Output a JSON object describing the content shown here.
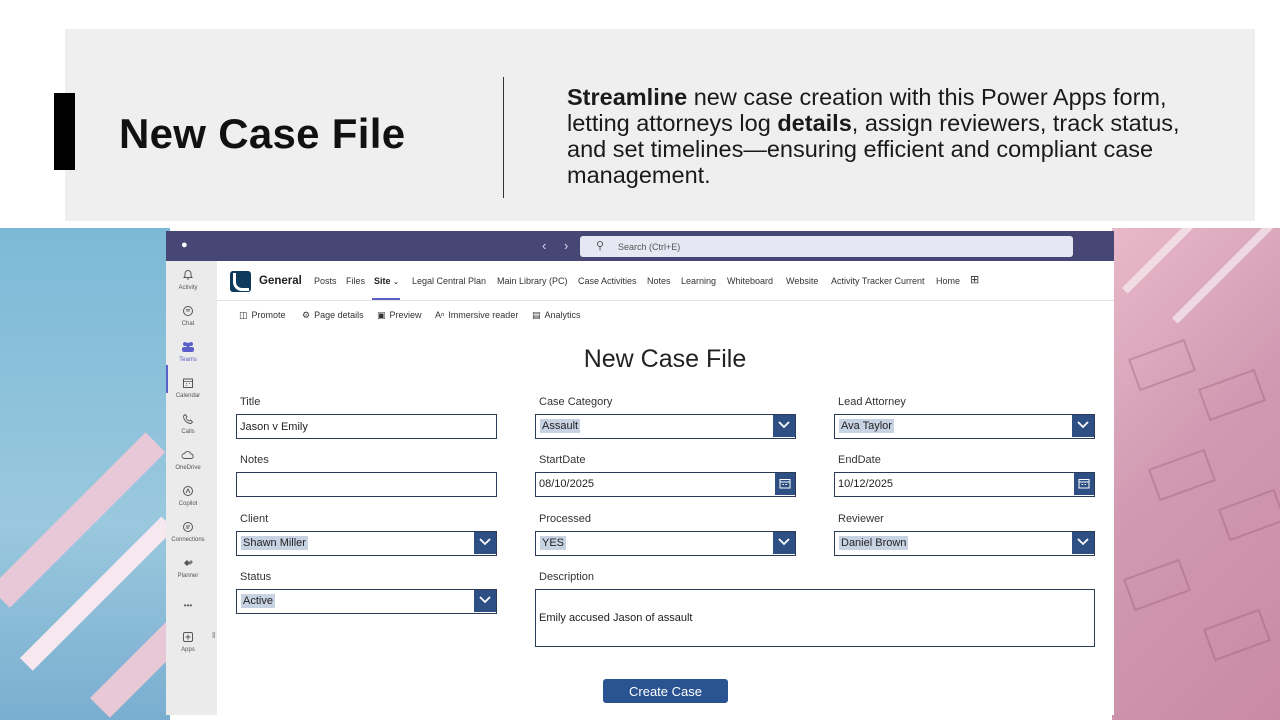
{
  "slide": {
    "title": "New Case File",
    "description_parts": {
      "bold1": "Streamline",
      "text1": " new case creation with this Power Apps form, letting attorneys log ",
      "bold2": "details",
      "text2": ", assign reviewers, track status, and set timelines—ensuring efficient and compliant case management."
    }
  },
  "window": {
    "search_placeholder": "Search (Ctrl+E)"
  },
  "rail": {
    "items": [
      {
        "label": "Activity",
        "icon": "bell-icon"
      },
      {
        "label": "Chat",
        "icon": "chat-icon"
      },
      {
        "label": "Teams",
        "icon": "teams-icon"
      },
      {
        "label": "Calendar",
        "icon": "calendar-icon"
      },
      {
        "label": "Calls",
        "icon": "phone-icon"
      },
      {
        "label": "OneDrive",
        "icon": "cloud-icon"
      },
      {
        "label": "Copilot",
        "icon": "copilot-icon"
      },
      {
        "label": "Connections",
        "icon": "connections-icon"
      },
      {
        "label": "Planner",
        "icon": "planner-icon"
      },
      {
        "label": "•••",
        "icon": "more-icon"
      },
      {
        "label": "Apps",
        "icon": "apps-icon"
      }
    ],
    "active": "Teams"
  },
  "channel": {
    "name": "General",
    "tabs": [
      "Posts",
      "Files",
      "Site",
      "Legal Central Plan",
      "Main Library (PC)",
      "Case Activities",
      "Notes",
      "Learning",
      "Whiteboard",
      "Website",
      "Activity Tracker Current",
      "Home"
    ],
    "active_tab": "Site"
  },
  "toolbar": {
    "items": [
      "Promote",
      "Page details",
      "Preview",
      "Immersive reader",
      "Analytics"
    ]
  },
  "form": {
    "title": "New Case File",
    "title_label": "Title",
    "title_value": "Jason v Emily",
    "notes_label": "Notes",
    "notes_value": "",
    "client_label": "Client",
    "client_value": "Shawn Miller",
    "status_label": "Status",
    "status_value": "Active",
    "case_category_label": "Case Category",
    "case_category_value": "Assault",
    "start_date_label": "StartDate",
    "start_date_value": "08/10/2025",
    "processed_label": "Processed",
    "processed_value": "YES",
    "description_label": "Description",
    "description_value": "Emily accused Jason of assault",
    "lead_attorney_label": "Lead Attorney",
    "lead_attorney_value": "Ava Taylor",
    "end_date_label": "EndDate",
    "end_date_value": "10/12/2025",
    "reviewer_label": "Reviewer",
    "reviewer_value": "Daniel Brown",
    "create_button": "Create Case"
  },
  "colors": {
    "teams_titlebar": "#464775",
    "form_accent": "#2d4f84",
    "selection_highlight": "#c7d3e3"
  }
}
